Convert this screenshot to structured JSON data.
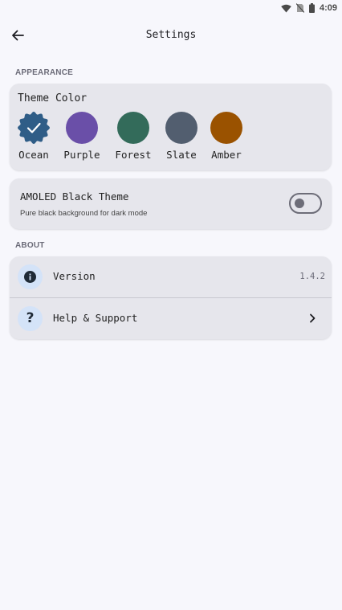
{
  "status_bar": {
    "time": "4:09"
  },
  "header": {
    "title": "Settings"
  },
  "appearance": {
    "section_label": "APPEARANCE",
    "theme_color": {
      "title": "Theme Color",
      "selected": "Ocean",
      "options": [
        {
          "label": "Ocean",
          "color": "#2f5d87"
        },
        {
          "label": "Purple",
          "color": "#6a4fa8"
        },
        {
          "label": "Forest",
          "color": "#336b5a"
        },
        {
          "label": "Slate",
          "color": "#525e6f"
        },
        {
          "label": "Amber",
          "color": "#9a5200"
        }
      ]
    },
    "amoled": {
      "title": "AMOLED Black Theme",
      "subtitle": "Pure black background for dark mode",
      "enabled": false
    }
  },
  "about": {
    "section_label": "ABOUT",
    "version": {
      "label": "Version",
      "value": "1.4.2",
      "icon": "info-icon"
    },
    "help": {
      "label": "Help & Support",
      "icon": "question-icon"
    }
  }
}
